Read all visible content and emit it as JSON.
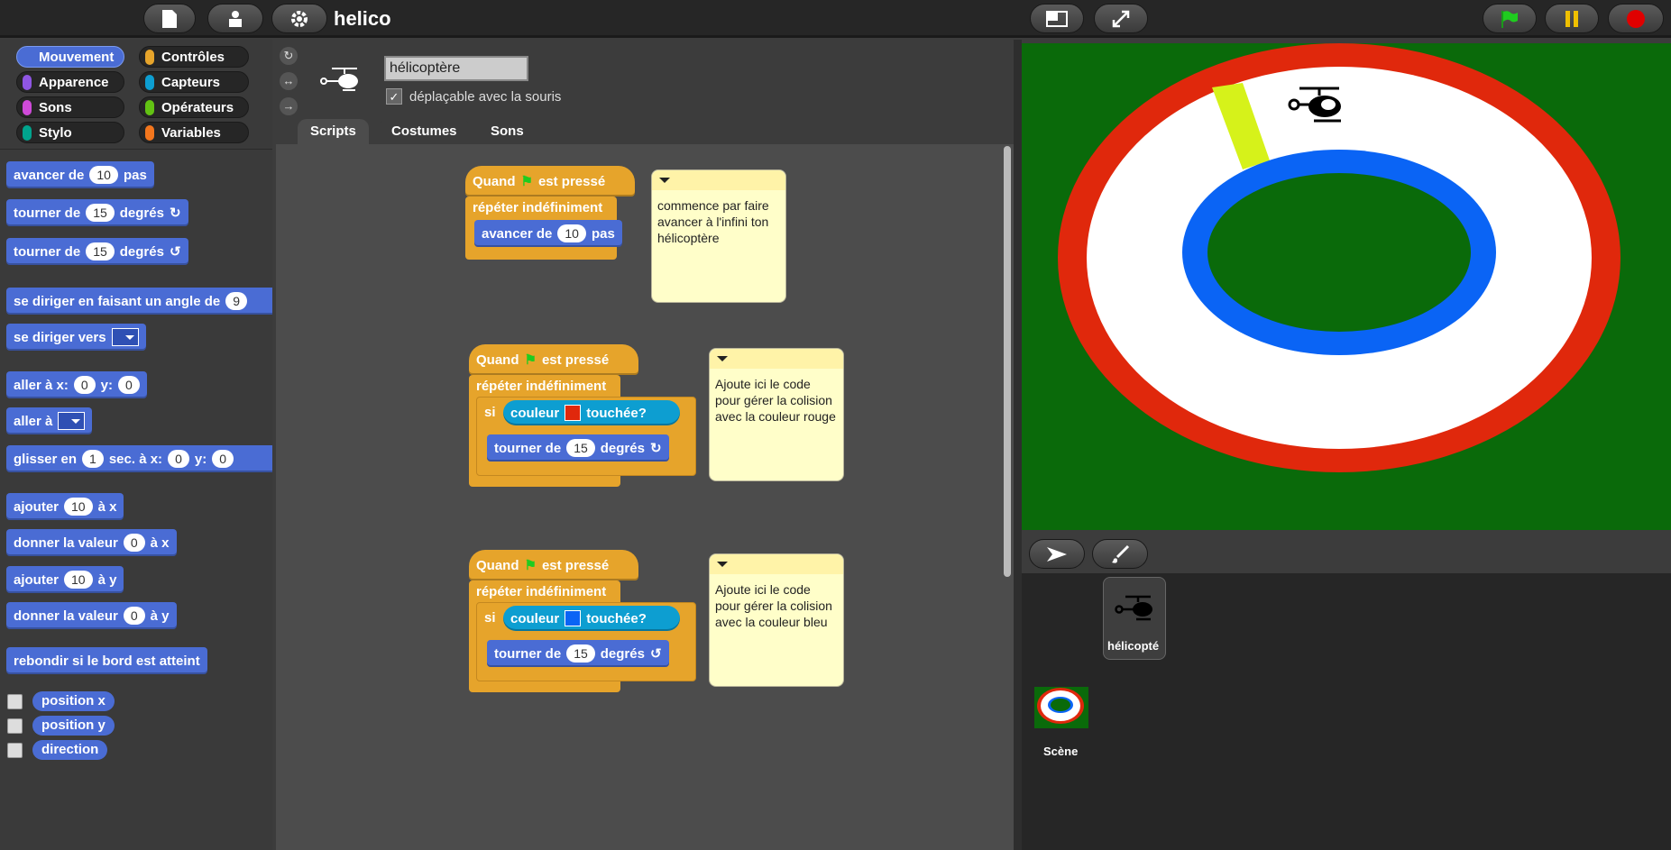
{
  "app": {
    "project_name": "helico"
  },
  "toolbar": {
    "file_icon": "file-icon",
    "cloud_icon": "cloud-icon",
    "settings_icon": "gear-icon",
    "stage_size_icon": "normal-stage-icon",
    "fullscreen_icon": "fullscreen-icon",
    "green_flag": "green-flag-icon",
    "pause": "pause-icon",
    "stop": "stop-icon"
  },
  "categories": [
    {
      "label": "Mouvement",
      "color": "#4a6cd4",
      "active": true
    },
    {
      "label": "Contrôles",
      "color": "#e6a42b"
    },
    {
      "label": "Apparence",
      "color": "#8f56e3"
    },
    {
      "label": "Capteurs",
      "color": "#0d9ed1"
    },
    {
      "label": "Sons",
      "color": "#cf4ad9"
    },
    {
      "label": "Opérateurs",
      "color": "#62c213"
    },
    {
      "label": "Stylo",
      "color": "#00a48d"
    },
    {
      "label": "Variables",
      "color": "#f3761d"
    }
  ],
  "palette": {
    "move_a": "avancer de",
    "move_b": "pas",
    "move_val": "10",
    "turn_a": "tourner de",
    "turn_b": "degrés",
    "turn_val": "15",
    "point_dir": "se diriger en faisant un angle de",
    "point_dir_val": "9",
    "point_to": "se diriger vers",
    "goto_xy_a": "aller à x:",
    "goto_xy_b": "y:",
    "goto_x": "0",
    "goto_y": "0",
    "goto": "aller à",
    "glide_a": "glisser en",
    "glide_b": "sec. à x:",
    "glide_c": "y:",
    "glide_t": "1",
    "glide_x": "0",
    "glide_y": "0",
    "changex_a": "ajouter",
    "changex_b": "à x",
    "changex_val": "10",
    "setx_a": "donner la valeur",
    "setx_b": "à x",
    "setx_val": "0",
    "changey_a": "ajouter",
    "changey_b": "à y",
    "changey_val": "10",
    "sety_a": "donner la valeur",
    "sety_b": "à y",
    "sety_val": "0",
    "bounce": "rebondir si le bord est atteint",
    "rep_x": "position x",
    "rep_y": "position y",
    "rep_dir": "direction"
  },
  "sprite": {
    "name": "hélicoptère",
    "draggable_label": "déplaçable avec la souris",
    "draggable": true
  },
  "tabs": [
    "Scripts",
    "Costumes",
    "Sons"
  ],
  "scripts": {
    "when": "Quand",
    "pressed": "est pressé",
    "forever": "répéter indéfiniment",
    "if": "si",
    "color": "couleur",
    "touching": "touchée?",
    "move": "avancer de",
    "move_val": "10",
    "steps": "pas",
    "turn": "tourner de",
    "turn_val": "15",
    "degrees": "degrés",
    "red": "#e0280c",
    "blue": "#0a64f5"
  },
  "notes": [
    "commence par faire avancer à l'infini ton hélicoptère",
    "Ajoute ici le code pour gérer la colision avec la couleur rouge",
    "Ajoute ici le code pour gérer la colision avec la couleur bleu"
  ],
  "corral": {
    "sprite_label": "hélicopté",
    "stage_label": "Scène"
  },
  "stage_colors": {
    "ground": "#0a6a0a",
    "red_ring": "#e0280c",
    "white_track": "#ffffff",
    "blue_ring": "#0a64f5",
    "finish": "#d6f21a"
  }
}
